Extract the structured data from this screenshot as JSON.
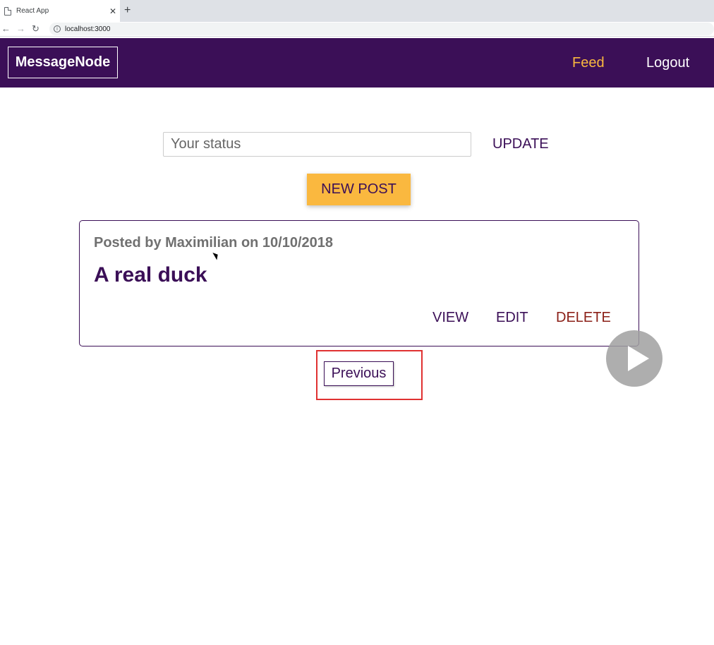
{
  "browser": {
    "tab_title": "React App",
    "tab_close": "✕",
    "new_tab": "+",
    "url": "localhost:3000"
  },
  "header": {
    "logo": "MessageNode",
    "nav": {
      "feed": "Feed",
      "logout": "Logout"
    }
  },
  "status": {
    "placeholder": "Your status",
    "update_label": "UPDATE"
  },
  "new_post_label": "NEW POST",
  "posts": [
    {
      "meta": "Posted by Maximilian on 10/10/2018",
      "title": "A real duck",
      "actions": {
        "view": "VIEW",
        "edit": "EDIT",
        "delete": "DELETE"
      }
    }
  ],
  "pagination": {
    "previous_label": "Previous"
  },
  "colors": {
    "primary": "#3b0f57",
    "accent": "#fab83f",
    "danger": "#8b1f17",
    "highlight": "#e03131"
  }
}
